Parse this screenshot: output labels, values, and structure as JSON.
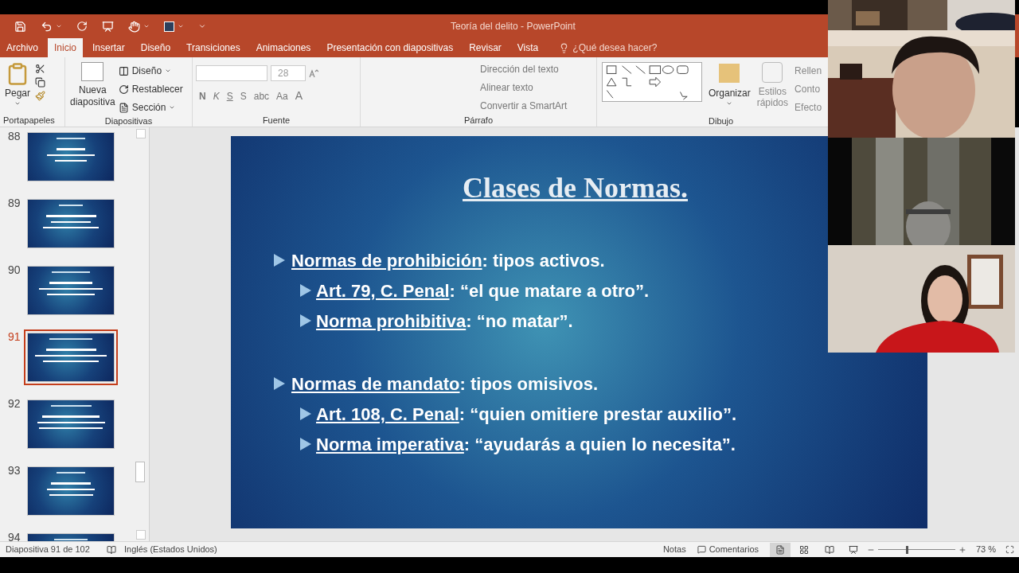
{
  "window": {
    "title": "Teoría del delito - PowerPoint"
  },
  "tabs": [
    {
      "label": "Archivo",
      "selected": false
    },
    {
      "label": "Inicio",
      "selected": true
    },
    {
      "label": "Insertar",
      "selected": false
    },
    {
      "label": "Diseño",
      "selected": false
    },
    {
      "label": "Transiciones",
      "selected": false
    },
    {
      "label": "Animaciones",
      "selected": false
    },
    {
      "label": "Presentación con diapositivas",
      "selected": false
    },
    {
      "label": "Revisar",
      "selected": false
    },
    {
      "label": "Vista",
      "selected": false
    }
  ],
  "tell_me": "¿Qué desea hacer?",
  "ribbon": {
    "clipboard": {
      "paste": "Pegar",
      "label": "Portapapeles"
    },
    "slides": {
      "new_slide": [
        "Nueva",
        "diapositiva"
      ],
      "layout": "Diseño",
      "reset": "Restablecer",
      "section": "Sección",
      "label": "Diapositivas"
    },
    "font": {
      "size": "28",
      "format_buttons": [
        "N",
        "K",
        "S",
        "S",
        "abc"
      ],
      "case": "Aa",
      "color_letter": "A",
      "label": "Fuente"
    },
    "paragraph": {
      "text_direction": "Dirección del texto",
      "align_text": "Alinear texto",
      "smartart": "Convertir a SmartArt",
      "label": "Párrafo"
    },
    "drawing": {
      "arrange": "Organizar",
      "quick_styles": [
        "Estilos",
        "rápidos"
      ],
      "fill": "Rellen",
      "outline": "Conto",
      "effects": "Efecto",
      "label": "Dibujo"
    }
  },
  "thumbnails": [
    {
      "number": "88",
      "selected": false
    },
    {
      "number": "89",
      "selected": false
    },
    {
      "number": "90",
      "selected": false
    },
    {
      "number": "91",
      "selected": true
    },
    {
      "number": "92",
      "selected": false
    },
    {
      "number": "93",
      "selected": false
    },
    {
      "number": "94",
      "selected": false
    }
  ],
  "slide": {
    "title": "Clases de Normas.",
    "groups": [
      {
        "term": "Normas de prohibición",
        "rest": ": tipos activos.",
        "children": [
          {
            "term": "Art. 79, C. Penal",
            "rest": ": “el que matare a otro”."
          },
          {
            "term": "Norma prohibitiva",
            "rest": ": “no matar”."
          }
        ]
      },
      {
        "term": "Normas de mandato",
        "rest": ": tipos omisivos.",
        "children": [
          {
            "term": "Art. 108, C. Penal",
            "rest": ": “quien omitiere prestar auxilio”."
          },
          {
            "term": "Norma imperativa",
            "rest": ": “ayudarás a quien lo necesita”."
          }
        ]
      }
    ]
  },
  "status_bar": {
    "slide": "Diapositiva 91 de 102",
    "language": "Inglés (Estados Unidos)",
    "notes": "Notas",
    "comments": "Comentarios",
    "zoom": {
      "level": 0.37
    },
    "zoom_text": "73 %"
  }
}
